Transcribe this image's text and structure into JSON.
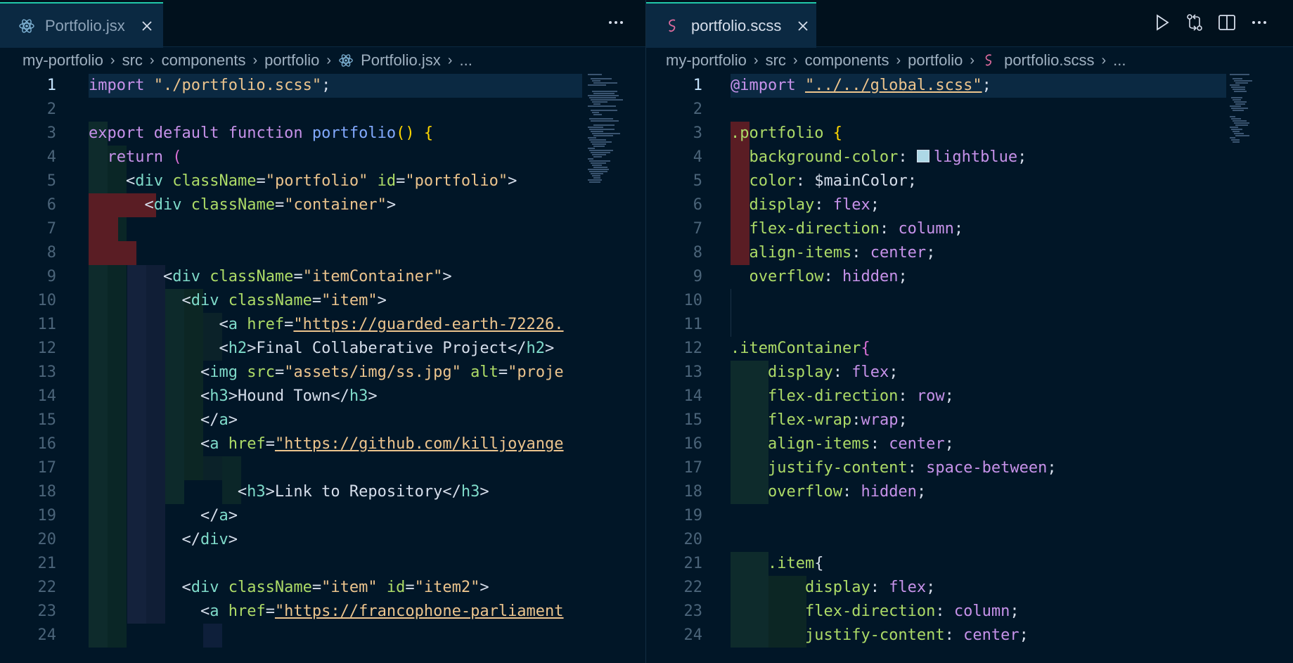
{
  "left": {
    "tab": {
      "label": "Portfolio.jsx",
      "icon": "react-icon"
    },
    "more_label": "···",
    "breadcrumb": [
      "my-portfolio",
      "src",
      "components",
      "portfolio",
      "Portfolio.jsx",
      "..."
    ]
  },
  "right": {
    "tab": {
      "label": "portfolio.scss",
      "icon": "sass-icon"
    },
    "more_label": "···",
    "breadcrumb": [
      "my-portfolio",
      "src",
      "components",
      "portfolio",
      "portfolio.scss",
      "..."
    ]
  },
  "colors": {
    "background": "#011627",
    "accent": "#21c7a8",
    "tabbar": "#01111d",
    "active_line": "#0b2942"
  },
  "jsx_lines": [
    [
      [
        "kw",
        "import"
      ],
      [
        "punct",
        " "
      ],
      [
        "str",
        "\"./portfolio.scss\""
      ],
      [
        "punct",
        ";"
      ]
    ],
    [],
    [
      [
        "kw",
        "export"
      ],
      [
        "punct",
        " "
      ],
      [
        "kw",
        "default"
      ],
      [
        "punct",
        " "
      ],
      [
        "kw",
        "function"
      ],
      [
        "punct",
        " "
      ],
      [
        "fn",
        "portfolio"
      ],
      [
        "paren",
        "()"
      ],
      [
        "punct",
        " "
      ],
      [
        "paren",
        "{"
      ]
    ],
    [
      [
        "punct",
        "  "
      ],
      [
        "kw",
        "return"
      ],
      [
        "punct",
        " "
      ],
      [
        "pink",
        "("
      ]
    ],
    [
      [
        "punct",
        "    "
      ],
      [
        "punct",
        "<"
      ],
      [
        "tag",
        "div"
      ],
      [
        "punct",
        " "
      ],
      [
        "attr",
        "className"
      ],
      [
        "punct",
        "="
      ],
      [
        "str",
        "\"portfolio\""
      ],
      [
        "punct",
        " "
      ],
      [
        "attr",
        "id"
      ],
      [
        "punct",
        "="
      ],
      [
        "str",
        "\"portfolio\""
      ],
      [
        "punct",
        ">"
      ]
    ],
    [
      [
        "punct",
        "      "
      ],
      [
        "punct",
        "<"
      ],
      [
        "tag",
        "div"
      ],
      [
        "punct",
        " "
      ],
      [
        "attr",
        "className"
      ],
      [
        "punct",
        "="
      ],
      [
        "str",
        "\"container\""
      ],
      [
        "punct",
        ">"
      ]
    ],
    [],
    [],
    [
      [
        "punct",
        "        "
      ],
      [
        "punct",
        "<"
      ],
      [
        "tag",
        "div"
      ],
      [
        "punct",
        " "
      ],
      [
        "attr",
        "className"
      ],
      [
        "punct",
        "="
      ],
      [
        "str",
        "\"itemContainer\""
      ],
      [
        "punct",
        ">"
      ]
    ],
    [
      [
        "punct",
        "          "
      ],
      [
        "punct",
        "<"
      ],
      [
        "tag",
        "div"
      ],
      [
        "punct",
        " "
      ],
      [
        "attr",
        "className"
      ],
      [
        "punct",
        "="
      ],
      [
        "str",
        "\"item\""
      ],
      [
        "punct",
        ">"
      ]
    ],
    [
      [
        "punct",
        "              "
      ],
      [
        "punct",
        "<"
      ],
      [
        "tag",
        "a"
      ],
      [
        "punct",
        " "
      ],
      [
        "attr",
        "href"
      ],
      [
        "punct",
        "="
      ],
      [
        "url",
        "\"https://guarded-earth-72226."
      ]
    ],
    [
      [
        "punct",
        "              "
      ],
      [
        "punct",
        "<"
      ],
      [
        "tag",
        "h2"
      ],
      [
        "punct",
        ">Final Collaberative Project</"
      ],
      [
        "tag",
        "h2"
      ],
      [
        "punct",
        ">"
      ]
    ],
    [
      [
        "punct",
        "            "
      ],
      [
        "punct",
        "<"
      ],
      [
        "tag",
        "img"
      ],
      [
        "punct",
        " "
      ],
      [
        "attr",
        "src"
      ],
      [
        "punct",
        "="
      ],
      [
        "str",
        "\"assets/img/ss.jpg\""
      ],
      [
        "punct",
        " "
      ],
      [
        "attr",
        "alt"
      ],
      [
        "punct",
        "="
      ],
      [
        "str",
        "\"proje"
      ]
    ],
    [
      [
        "punct",
        "            "
      ],
      [
        "punct",
        "<"
      ],
      [
        "tag",
        "h3"
      ],
      [
        "punct",
        ">Hound Town</"
      ],
      [
        "tag",
        "h3"
      ],
      [
        "punct",
        ">"
      ]
    ],
    [
      [
        "punct",
        "            "
      ],
      [
        "punct",
        "</"
      ],
      [
        "tag",
        "a"
      ],
      [
        "punct",
        ">"
      ]
    ],
    [
      [
        "punct",
        "            "
      ],
      [
        "punct",
        "<"
      ],
      [
        "tag",
        "a"
      ],
      [
        "punct",
        " "
      ],
      [
        "attr",
        "href"
      ],
      [
        "punct",
        "="
      ],
      [
        "url",
        "\"https://github.com/killjoyange"
      ]
    ],
    [],
    [
      [
        "punct",
        "                "
      ],
      [
        "punct",
        "<"
      ],
      [
        "tag",
        "h3"
      ],
      [
        "punct",
        ">Link to Repository</"
      ],
      [
        "tag",
        "h3"
      ],
      [
        "punct",
        ">"
      ]
    ],
    [
      [
        "punct",
        "            "
      ],
      [
        "punct",
        "</"
      ],
      [
        "tag",
        "a"
      ],
      [
        "punct",
        ">"
      ]
    ],
    [
      [
        "punct",
        "          "
      ],
      [
        "punct",
        "</"
      ],
      [
        "tag",
        "div"
      ],
      [
        "punct",
        ">"
      ]
    ],
    [],
    [
      [
        "punct",
        "          "
      ],
      [
        "punct",
        "<"
      ],
      [
        "tag",
        "div"
      ],
      [
        "punct",
        " "
      ],
      [
        "attr",
        "className"
      ],
      [
        "punct",
        "="
      ],
      [
        "str",
        "\"item\""
      ],
      [
        "punct",
        " "
      ],
      [
        "attr",
        "id"
      ],
      [
        "punct",
        "="
      ],
      [
        "str",
        "\"item2\""
      ],
      [
        "punct",
        ">"
      ]
    ],
    [
      [
        "punct",
        "            "
      ],
      [
        "punct",
        "<"
      ],
      [
        "tag",
        "a"
      ],
      [
        "punct",
        " "
      ],
      [
        "attr",
        "href"
      ],
      [
        "punct",
        "="
      ],
      [
        "url",
        "\"https://francophone-parliament"
      ]
    ],
    []
  ],
  "scss_lines": [
    [
      [
        "kw",
        "@import"
      ],
      [
        "punct",
        " "
      ],
      [
        "url",
        "\"../../global.scss\""
      ],
      [
        "punct",
        ";"
      ]
    ],
    [],
    [
      [
        "cls",
        ".portfolio"
      ],
      [
        "punct",
        " "
      ],
      [
        "paren",
        "{"
      ]
    ],
    [
      [
        "punct",
        "  "
      ],
      [
        "prop",
        "background-color"
      ],
      [
        "punct",
        ": "
      ],
      [
        "swatch",
        ""
      ],
      [
        "kw",
        "lightblue"
      ],
      [
        "punct",
        ";"
      ]
    ],
    [
      [
        "punct",
        "  "
      ],
      [
        "prop",
        "color"
      ],
      [
        "punct",
        ": "
      ],
      [
        "var",
        "$mainColor"
      ],
      [
        "punct",
        ";"
      ]
    ],
    [
      [
        "punct",
        "  "
      ],
      [
        "prop",
        "display"
      ],
      [
        "punct",
        ": "
      ],
      [
        "kw",
        "flex"
      ],
      [
        "punct",
        ";"
      ]
    ],
    [
      [
        "punct",
        "  "
      ],
      [
        "prop",
        "flex-direction"
      ],
      [
        "punct",
        ": "
      ],
      [
        "kw",
        "column"
      ],
      [
        "punct",
        ";"
      ]
    ],
    [
      [
        "punct",
        "  "
      ],
      [
        "prop",
        "align-items"
      ],
      [
        "punct",
        ": "
      ],
      [
        "kw",
        "center"
      ],
      [
        "punct",
        ";"
      ]
    ],
    [
      [
        "punct",
        "  "
      ],
      [
        "prop",
        "overflow"
      ],
      [
        "punct",
        ": "
      ],
      [
        "kw",
        "hidden"
      ],
      [
        "punct",
        ";"
      ]
    ],
    [],
    [],
    [
      [
        "cls",
        ".itemContainer"
      ],
      [
        "pink",
        "{"
      ]
    ],
    [
      [
        "punct",
        "    "
      ],
      [
        "prop",
        "display"
      ],
      [
        "punct",
        ": "
      ],
      [
        "kw",
        "flex"
      ],
      [
        "punct",
        ";"
      ]
    ],
    [
      [
        "punct",
        "    "
      ],
      [
        "prop",
        "flex-direction"
      ],
      [
        "punct",
        ": "
      ],
      [
        "kw",
        "row"
      ],
      [
        "punct",
        ";"
      ]
    ],
    [
      [
        "punct",
        "    "
      ],
      [
        "prop",
        "flex-wrap"
      ],
      [
        "punct",
        ":"
      ],
      [
        "kw",
        "wrap"
      ],
      [
        "punct",
        ";"
      ]
    ],
    [
      [
        "punct",
        "    "
      ],
      [
        "prop",
        "align-items"
      ],
      [
        "punct",
        ": "
      ],
      [
        "kw",
        "center"
      ],
      [
        "punct",
        ";"
      ]
    ],
    [
      [
        "punct",
        "    "
      ],
      [
        "prop",
        "justify-content"
      ],
      [
        "punct",
        ": "
      ],
      [
        "kw",
        "space-between"
      ],
      [
        "punct",
        ";"
      ]
    ],
    [
      [
        "punct",
        "    "
      ],
      [
        "prop",
        "overflow"
      ],
      [
        "punct",
        ": "
      ],
      [
        "kw",
        "hidden"
      ],
      [
        "punct",
        ";"
      ]
    ],
    [],
    [],
    [
      [
        "punct",
        "    "
      ],
      [
        "cls",
        ".item"
      ],
      [
        "punct",
        "{"
      ]
    ],
    [
      [
        "punct",
        "        "
      ],
      [
        "prop",
        "display"
      ],
      [
        "punct",
        ": "
      ],
      [
        "kw",
        "flex"
      ],
      [
        "punct",
        ";"
      ]
    ],
    [
      [
        "punct",
        "        "
      ],
      [
        "prop",
        "flex-direction"
      ],
      [
        "punct",
        ": "
      ],
      [
        "kw",
        "column"
      ],
      [
        "punct",
        ";"
      ]
    ],
    [
      [
        "punct",
        "        "
      ],
      [
        "prop",
        "justify-content"
      ],
      [
        "punct",
        ": "
      ],
      [
        "kw",
        "center"
      ],
      [
        "punct",
        ";"
      ]
    ]
  ]
}
